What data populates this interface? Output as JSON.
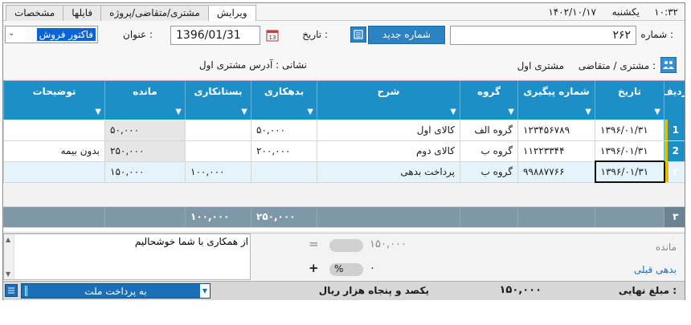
{
  "topbar": {
    "clock": "۱۰:۳۲",
    "day_name": "یکشنبه",
    "date": "۱۴۰۲/۱۰/۱۷"
  },
  "tabs": [
    {
      "label": "ویرایش",
      "active": true
    },
    {
      "label": "مشتری/متقاضی/پروژه",
      "active": false
    },
    {
      "label": "فایلها",
      "active": false
    },
    {
      "label": "مشخصات",
      "active": false
    }
  ],
  "header": {
    "number_label": "شماره :",
    "number_value": "۲۶۲",
    "new_number_button": "شماره جدید",
    "date_label": "تاریخ :",
    "date_value": "1396/01/31",
    "title_label": "عنوان :",
    "title_value": "فاکتور فروش",
    "customer_label": "مشتری / متقاضی :",
    "customer_value": "مشتری اول",
    "address_label": "نشانی : آدرس مشتری اول"
  },
  "grid": {
    "columns": [
      "ردیف",
      "تاریخ",
      "شماره پیگیری",
      "گروه",
      "شرح",
      "بدهکاری",
      "بستانکاری",
      "مانده",
      "توضیحات"
    ],
    "rows": [
      {
        "row": "1",
        "date": "۱۳۹۶/۰۱/۳۱",
        "tracking": "۱۲۳۴۵۶۷۸۹",
        "group": "گروه الف",
        "desc": "کالای اول",
        "debit": "۵۰,۰۰۰",
        "credit": "",
        "balance": "۵۰,۰۰۰",
        "notes": ""
      },
      {
        "row": "2",
        "date": "۱۳۹۶/۰۱/۳۱",
        "tracking": "۱۱۲۲۳۳۴۴",
        "group": "گروه ب",
        "desc": "کالای دوم",
        "debit": "۲۰۰,۰۰۰",
        "credit": "",
        "balance": "۲۵۰,۰۰۰",
        "notes": "بدون بیمه"
      },
      {
        "row": "۳",
        "date": "۱۳۹۶/۰۱/۳۱",
        "tracking": "۹۹۸۸۷۷۶۶",
        "group": "گروه ب",
        "desc": "پرداخت بدهی",
        "debit": "",
        "credit": "۱۰۰,۰۰۰",
        "balance": "۱۵۰,۰۰۰",
        "notes": ""
      }
    ],
    "totals": {
      "count": "۳",
      "debit": "۲۵۰,۰۰۰",
      "credit": "۱۰۰,۰۰۰"
    }
  },
  "bottom": {
    "notes_text": "از همکاری با شما خوشحالیم",
    "remain_label": "مانده",
    "prev_debt_label": "بدهی قبلی",
    "amount_value": "۱۵۰,۰۰۰",
    "zero_value": "۰",
    "percent": "%",
    "equals": "=",
    "plus": "+"
  },
  "footer": {
    "final_label": "مبلغ نهایی :",
    "final_value": "۱۵۰,۰۰۰",
    "amount_words": "یکصد و پنجاه  هزار  ریال",
    "payment_method": "به پرداخت ملت"
  },
  "colors": {
    "header_blue": "#1e8fc6",
    "button_blue": "#2b83c4",
    "totals_gray": "#7e98a8",
    "row_marker": "#e0c000"
  }
}
